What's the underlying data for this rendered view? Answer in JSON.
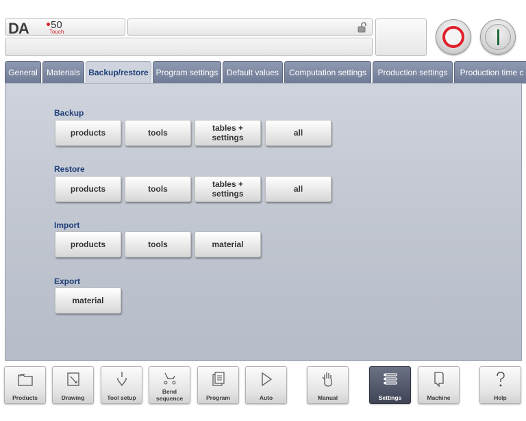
{
  "header": {
    "logo_da": "DA",
    "logo_model": "50",
    "logo_touch": "Touch",
    "lock_icon": "unlock-icon",
    "stop_icon": "stop-icon",
    "start_icon": "start-icon",
    "stop_color": "#e0202a",
    "start_color": "#1c6a3a"
  },
  "tabs": [
    {
      "label": "General",
      "active": false
    },
    {
      "label": "Materials",
      "active": false
    },
    {
      "label": "Backup/restore",
      "active": true
    },
    {
      "label": "Program settings",
      "active": false
    },
    {
      "label": "Default values",
      "active": false
    },
    {
      "label": "Computation settings",
      "active": false
    },
    {
      "label": "Production settings",
      "active": false
    },
    {
      "label": "Production time c",
      "active": false
    }
  ],
  "sections": {
    "backup": {
      "title": "Backup",
      "buttons": [
        "products",
        "tools",
        "tables +\nsettings",
        "all"
      ]
    },
    "restore": {
      "title": "Restore",
      "buttons": [
        "products",
        "tools",
        "tables +\nsettings",
        "all"
      ]
    },
    "import": {
      "title": "Import",
      "buttons": [
        "products",
        "tools",
        "material"
      ]
    },
    "export": {
      "title": "Export",
      "buttons": [
        "material"
      ]
    }
  },
  "nav": [
    {
      "label": "Products",
      "icon": "folder-icon",
      "active": false
    },
    {
      "label": "Drawing",
      "icon": "pencil-icon",
      "active": false
    },
    {
      "label": "Tool setup",
      "icon": "tool-setup-icon",
      "active": false
    },
    {
      "label": "Bend\nsequence",
      "icon": "bend-sequence-icon",
      "active": false
    },
    {
      "label": "Program",
      "icon": "program-icon",
      "active": false
    },
    {
      "label": "Auto",
      "icon": "play-icon",
      "active": false
    },
    {
      "label": "Manual",
      "icon": "hand-icon",
      "active": false
    },
    {
      "label": "Settings",
      "icon": "settings-list-icon",
      "active": true
    },
    {
      "label": "Machine",
      "icon": "machine-icon",
      "active": false
    },
    {
      "label": "Help",
      "icon": "help-icon",
      "active": false
    }
  ],
  "colors": {
    "accent": "#1e3f78",
    "tab_bg": "#7a85a0",
    "panel_bg": "#c3c8d2"
  }
}
